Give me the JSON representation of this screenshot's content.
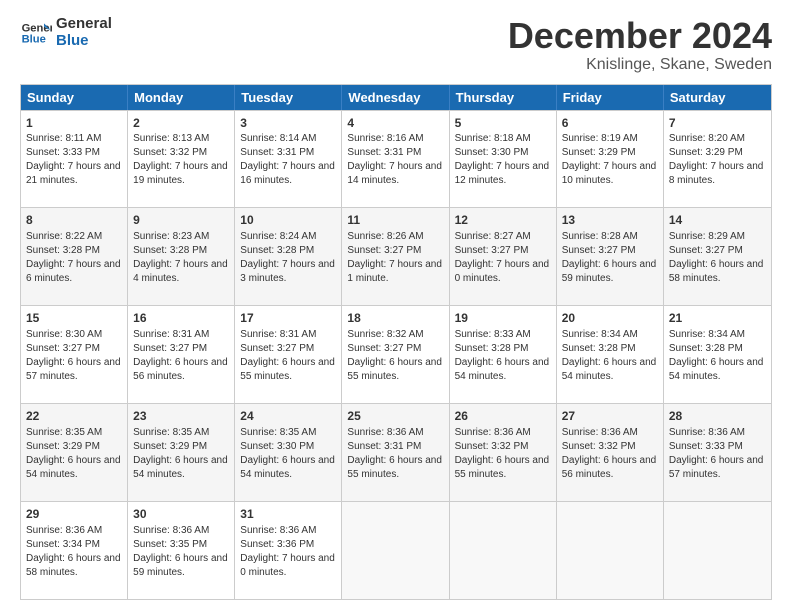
{
  "logo": {
    "line1": "General",
    "line2": "Blue"
  },
  "title": "December 2024",
  "subtitle": "Knislinge, Skane, Sweden",
  "header_days": [
    "Sunday",
    "Monday",
    "Tuesday",
    "Wednesday",
    "Thursday",
    "Friday",
    "Saturday"
  ],
  "weeks": [
    [
      {
        "day": "1",
        "sunrise": "Sunrise: 8:11 AM",
        "sunset": "Sunset: 3:33 PM",
        "daylight": "Daylight: 7 hours and 21 minutes."
      },
      {
        "day": "2",
        "sunrise": "Sunrise: 8:13 AM",
        "sunset": "Sunset: 3:32 PM",
        "daylight": "Daylight: 7 hours and 19 minutes."
      },
      {
        "day": "3",
        "sunrise": "Sunrise: 8:14 AM",
        "sunset": "Sunset: 3:31 PM",
        "daylight": "Daylight: 7 hours and 16 minutes."
      },
      {
        "day": "4",
        "sunrise": "Sunrise: 8:16 AM",
        "sunset": "Sunset: 3:31 PM",
        "daylight": "Daylight: 7 hours and 14 minutes."
      },
      {
        "day": "5",
        "sunrise": "Sunrise: 8:18 AM",
        "sunset": "Sunset: 3:30 PM",
        "daylight": "Daylight: 7 hours and 12 minutes."
      },
      {
        "day": "6",
        "sunrise": "Sunrise: 8:19 AM",
        "sunset": "Sunset: 3:29 PM",
        "daylight": "Daylight: 7 hours and 10 minutes."
      },
      {
        "day": "7",
        "sunrise": "Sunrise: 8:20 AM",
        "sunset": "Sunset: 3:29 PM",
        "daylight": "Daylight: 7 hours and 8 minutes."
      }
    ],
    [
      {
        "day": "8",
        "sunrise": "Sunrise: 8:22 AM",
        "sunset": "Sunset: 3:28 PM",
        "daylight": "Daylight: 7 hours and 6 minutes."
      },
      {
        "day": "9",
        "sunrise": "Sunrise: 8:23 AM",
        "sunset": "Sunset: 3:28 PM",
        "daylight": "Daylight: 7 hours and 4 minutes."
      },
      {
        "day": "10",
        "sunrise": "Sunrise: 8:24 AM",
        "sunset": "Sunset: 3:28 PM",
        "daylight": "Daylight: 7 hours and 3 minutes."
      },
      {
        "day": "11",
        "sunrise": "Sunrise: 8:26 AM",
        "sunset": "Sunset: 3:27 PM",
        "daylight": "Daylight: 7 hours and 1 minute."
      },
      {
        "day": "12",
        "sunrise": "Sunrise: 8:27 AM",
        "sunset": "Sunset: 3:27 PM",
        "daylight": "Daylight: 7 hours and 0 minutes."
      },
      {
        "day": "13",
        "sunrise": "Sunrise: 8:28 AM",
        "sunset": "Sunset: 3:27 PM",
        "daylight": "Daylight: 6 hours and 59 minutes."
      },
      {
        "day": "14",
        "sunrise": "Sunrise: 8:29 AM",
        "sunset": "Sunset: 3:27 PM",
        "daylight": "Daylight: 6 hours and 58 minutes."
      }
    ],
    [
      {
        "day": "15",
        "sunrise": "Sunrise: 8:30 AM",
        "sunset": "Sunset: 3:27 PM",
        "daylight": "Daylight: 6 hours and 57 minutes."
      },
      {
        "day": "16",
        "sunrise": "Sunrise: 8:31 AM",
        "sunset": "Sunset: 3:27 PM",
        "daylight": "Daylight: 6 hours and 56 minutes."
      },
      {
        "day": "17",
        "sunrise": "Sunrise: 8:31 AM",
        "sunset": "Sunset: 3:27 PM",
        "daylight": "Daylight: 6 hours and 55 minutes."
      },
      {
        "day": "18",
        "sunrise": "Sunrise: 8:32 AM",
        "sunset": "Sunset: 3:27 PM",
        "daylight": "Daylight: 6 hours and 55 minutes."
      },
      {
        "day": "19",
        "sunrise": "Sunrise: 8:33 AM",
        "sunset": "Sunset: 3:28 PM",
        "daylight": "Daylight: 6 hours and 54 minutes."
      },
      {
        "day": "20",
        "sunrise": "Sunrise: 8:34 AM",
        "sunset": "Sunset: 3:28 PM",
        "daylight": "Daylight: 6 hours and 54 minutes."
      },
      {
        "day": "21",
        "sunrise": "Sunrise: 8:34 AM",
        "sunset": "Sunset: 3:28 PM",
        "daylight": "Daylight: 6 hours and 54 minutes."
      }
    ],
    [
      {
        "day": "22",
        "sunrise": "Sunrise: 8:35 AM",
        "sunset": "Sunset: 3:29 PM",
        "daylight": "Daylight: 6 hours and 54 minutes."
      },
      {
        "day": "23",
        "sunrise": "Sunrise: 8:35 AM",
        "sunset": "Sunset: 3:29 PM",
        "daylight": "Daylight: 6 hours and 54 minutes."
      },
      {
        "day": "24",
        "sunrise": "Sunrise: 8:35 AM",
        "sunset": "Sunset: 3:30 PM",
        "daylight": "Daylight: 6 hours and 54 minutes."
      },
      {
        "day": "25",
        "sunrise": "Sunrise: 8:36 AM",
        "sunset": "Sunset: 3:31 PM",
        "daylight": "Daylight: 6 hours and 55 minutes."
      },
      {
        "day": "26",
        "sunrise": "Sunrise: 8:36 AM",
        "sunset": "Sunset: 3:32 PM",
        "daylight": "Daylight: 6 hours and 55 minutes."
      },
      {
        "day": "27",
        "sunrise": "Sunrise: 8:36 AM",
        "sunset": "Sunset: 3:32 PM",
        "daylight": "Daylight: 6 hours and 56 minutes."
      },
      {
        "day": "28",
        "sunrise": "Sunrise: 8:36 AM",
        "sunset": "Sunset: 3:33 PM",
        "daylight": "Daylight: 6 hours and 57 minutes."
      }
    ],
    [
      {
        "day": "29",
        "sunrise": "Sunrise: 8:36 AM",
        "sunset": "Sunset: 3:34 PM",
        "daylight": "Daylight: 6 hours and 58 minutes."
      },
      {
        "day": "30",
        "sunrise": "Sunrise: 8:36 AM",
        "sunset": "Sunset: 3:35 PM",
        "daylight": "Daylight: 6 hours and 59 minutes."
      },
      {
        "day": "31",
        "sunrise": "Sunrise: 8:36 AM",
        "sunset": "Sunset: 3:36 PM",
        "daylight": "Daylight: 7 hours and 0 minutes."
      },
      {
        "day": "",
        "sunrise": "",
        "sunset": "",
        "daylight": ""
      },
      {
        "day": "",
        "sunrise": "",
        "sunset": "",
        "daylight": ""
      },
      {
        "day": "",
        "sunrise": "",
        "sunset": "",
        "daylight": ""
      },
      {
        "day": "",
        "sunrise": "",
        "sunset": "",
        "daylight": ""
      }
    ]
  ]
}
